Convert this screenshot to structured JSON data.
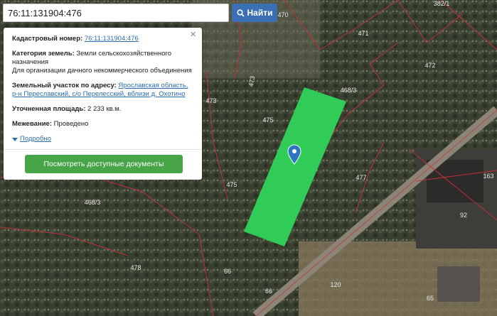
{
  "search": {
    "value": "76:11:131904:476",
    "button_label": "Найти"
  },
  "popup": {
    "cadastral_label": "Кадастровый номер:",
    "cadastral_value": "76:11:131904:476",
    "category_label": "Категория земель:",
    "category_value": "Земли сельскохозяйственного назначения",
    "purpose": "Для организации дачного некоммерческого объединения",
    "address_label": "Земельный участок по адресу:",
    "address_value_1": "Ярославская область,",
    "address_value_2": "р-н Переславский, с/о Перелесский, вблизи д. Охотино",
    "area_label": "Уточненная площадь:",
    "area_value": "2 233 кв.м.",
    "survey_label": "Межевание:",
    "survey_value": "Проведено",
    "more_label": "Подробно",
    "docs_button": "Посмотреть доступные документы",
    "close_symbol": "×"
  },
  "map": {
    "parcel_labels": [
      "470",
      "382/1",
      "471",
      "472",
      "473",
      "468/3",
      "473",
      "475",
      "477",
      "468/3",
      "475",
      "163",
      "92",
      "478",
      "66",
      "66",
      "120",
      "65"
    ],
    "highlight_color": "#2fd45a",
    "boundary_color": "#c0303a",
    "marker_icon": "map-pin-icon"
  }
}
